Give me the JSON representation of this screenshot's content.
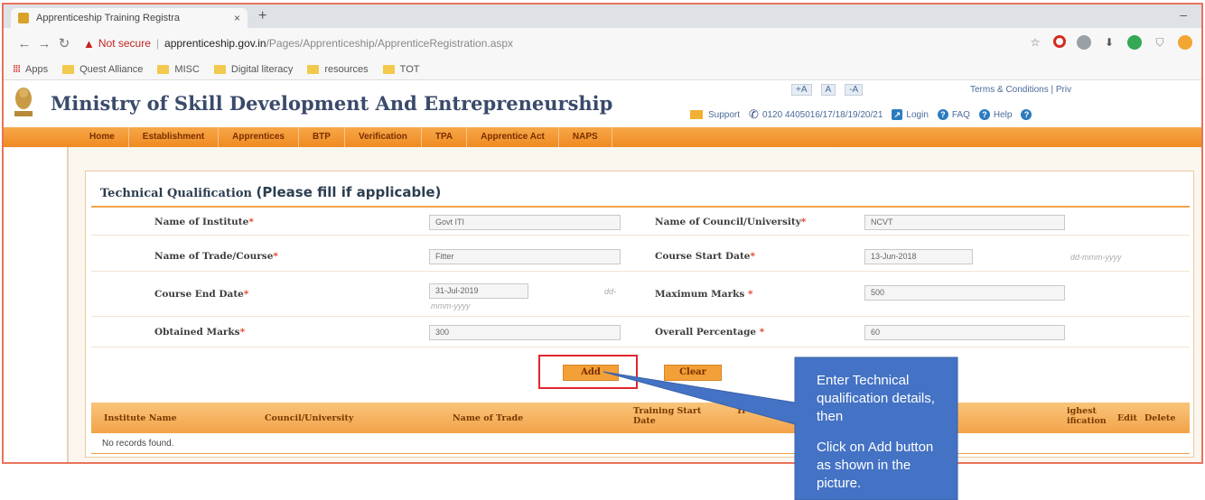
{
  "browser": {
    "tab_title": "Apprenticeship Training Registra",
    "tab_close": "×",
    "new_tab": "+",
    "minimize": "–",
    "not_secure": "Not secure",
    "url_host": "apprenticeship.gov.in",
    "url_path": "/Pages/Apprenticeship/ApprenticeRegistration.aspx",
    "bookmarks": [
      {
        "label": "Apps",
        "icon": "apps-grid-icon"
      },
      {
        "label": "Quest Alliance",
        "icon": "folder-icon"
      },
      {
        "label": "MISC",
        "icon": "folder-icon"
      },
      {
        "label": "Digital literacy",
        "icon": "folder-icon"
      },
      {
        "label": "resources",
        "icon": "folder-icon"
      },
      {
        "label": "TOT",
        "icon": "folder-icon"
      }
    ]
  },
  "header": {
    "title": "Ministry of Skill Development And Entrepreneurship",
    "font_controls": [
      "+A",
      "A",
      "-A"
    ],
    "terms": "Terms & Conditions | Priv",
    "support": "Support",
    "phone": "0120 4405016/17/18/19/20/21",
    "login": "Login",
    "faq": "FAQ",
    "help": "Help"
  },
  "nav": {
    "items": [
      "Home",
      "Establishment",
      "Apprentices",
      "BTP",
      "Verification",
      "TPA",
      "Apprentice Act",
      "NAPS"
    ]
  },
  "form": {
    "section_title": "Technical Qualification",
    "section_hint": "(Please fill if applicable)",
    "required_mark": "*",
    "fields": {
      "institute": {
        "label": "Name of Institute",
        "value": "Govt ITI"
      },
      "council": {
        "label": "Name of Council/University",
        "value": "NCVT"
      },
      "trade": {
        "label": "Name of Trade/Course",
        "value": "Fitter"
      },
      "start_date": {
        "label": "Course Start Date",
        "value": "13-Jun-2018",
        "format": "dd-mmm-yyyy"
      },
      "end_date": {
        "label": "Course End Date",
        "value": "31-Jul-2019",
        "format_a": "dd-",
        "format_b": "mmm-yyyy"
      },
      "max_marks": {
        "label": "Maximum Marks",
        "value": "500"
      },
      "obtained": {
        "label": "Obtained Marks",
        "value": "300"
      },
      "percentage": {
        "label": "Overall Percentage",
        "value": "60"
      }
    },
    "add_label": "Add",
    "clear_label": "Clear"
  },
  "grid": {
    "col_institute": "Institute Name",
    "col_council": "Council/University",
    "col_trade": "Name of Trade",
    "col_start_a": "Training Start",
    "col_start_b": "Date",
    "col_fragment": "Tr",
    "col_highest_a": "ighest",
    "col_highest_b": "ification",
    "col_edit": "Edit",
    "col_delete": "Delete",
    "empty": "No records found."
  },
  "callout": {
    "line1": "Enter Technical qualification details, then",
    "line2": "Click on Add button as shown in the picture.",
    "color": "#4472c4"
  }
}
